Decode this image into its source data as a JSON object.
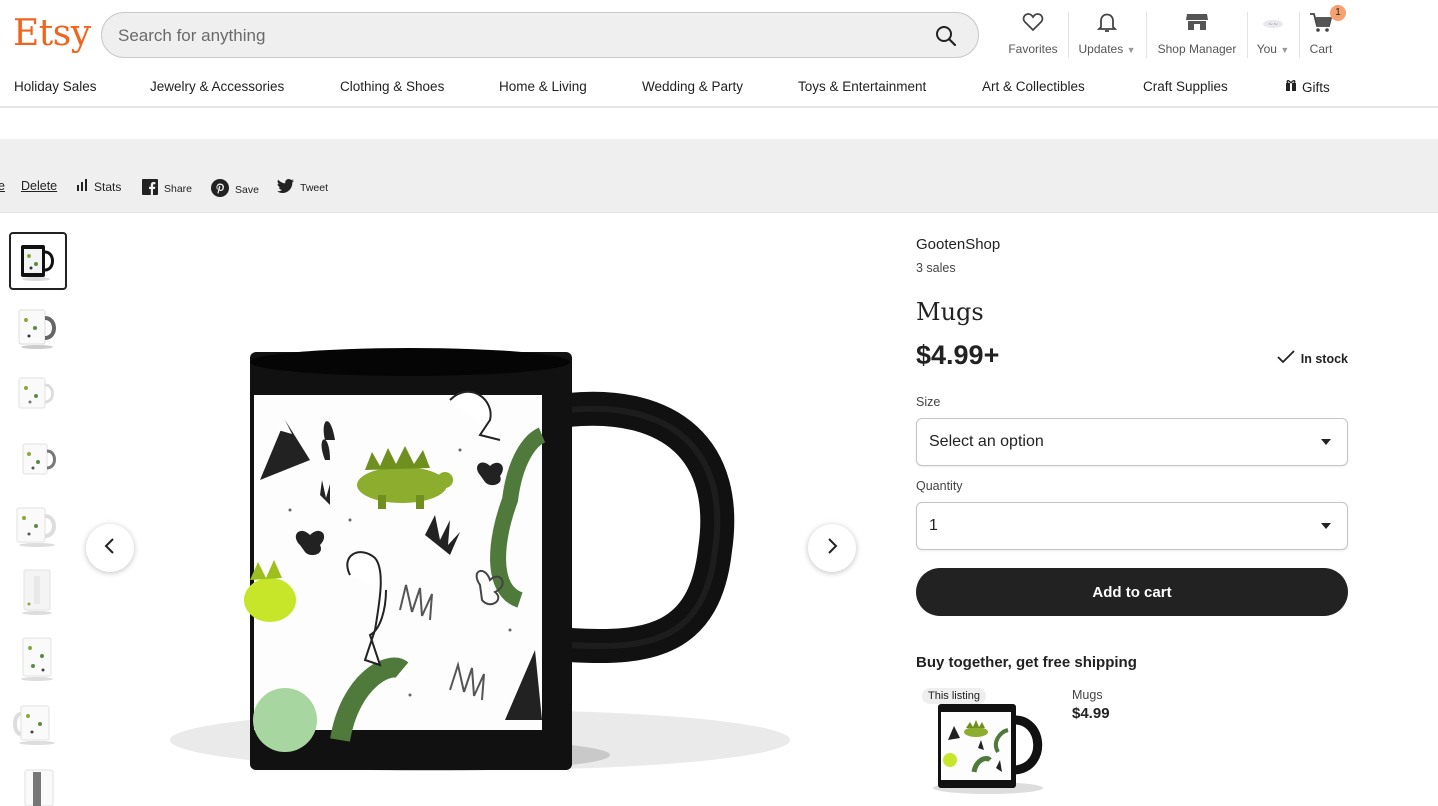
{
  "header": {
    "logo": "Etsy",
    "search_placeholder": "Search for anything",
    "nav": {
      "favorites": "Favorites",
      "updates": "Updates",
      "shop_manager": "Shop Manager",
      "you": "You",
      "cart": "Cart",
      "cart_count": "1"
    }
  },
  "categories": [
    "Holiday Sales",
    "Jewelry & Accessories",
    "Clothing & Shoes",
    "Home & Living",
    "Wedding & Party",
    "Toys & Entertainment",
    "Art & Collectibles",
    "Craft Supplies",
    "Gifts"
  ],
  "manage_bar": {
    "edit_fragment": "e",
    "delete": "Delete",
    "stats": "Stats",
    "share": "Share",
    "save": "Save",
    "tweet": "Tweet"
  },
  "listing": {
    "shop_name": "GootenShop",
    "sales": "3 sales",
    "title": "Mugs",
    "price": "$4.99+",
    "stock": "In stock",
    "size_label": "Size",
    "size_value": "Select an option",
    "quantity_label": "Quantity",
    "quantity_value": "1",
    "add_to_cart": "Add to cart"
  },
  "buy_together": {
    "title": "Buy together, get free shipping",
    "badge": "This listing",
    "item_name": "Mugs",
    "item_price": "$4.99"
  },
  "colors": {
    "brand": "#f1641e",
    "button": "#222222",
    "cart_badge": "#f5a170",
    "manage_bar_bg": "#efefef"
  }
}
